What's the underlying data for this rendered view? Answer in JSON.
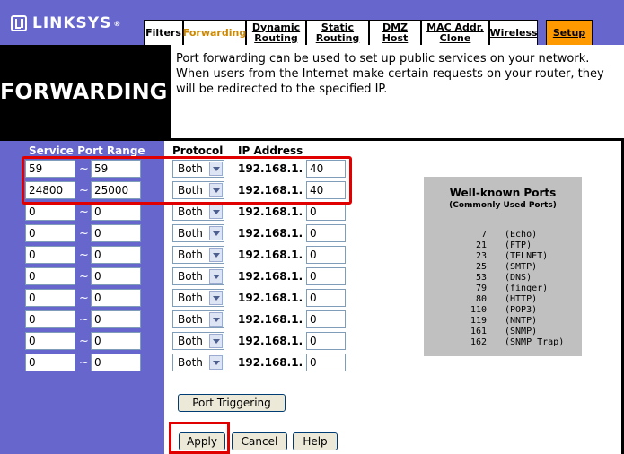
{
  "brand": {
    "name": "LINKSYS",
    "mark": "®"
  },
  "tabs": [
    {
      "label": "Filters",
      "underline": false
    },
    {
      "label": "Forwarding",
      "underline": false,
      "active": true
    },
    {
      "label": "Dynamic Routing",
      "underline": true
    },
    {
      "label": "Static Routing",
      "underline": true
    },
    {
      "label": "DMZ Host",
      "underline": true
    },
    {
      "label": "MAC Addr. Clone",
      "underline": true
    },
    {
      "label": "Wireless",
      "underline": true
    },
    {
      "label": "Setup",
      "underline": true,
      "accent": true
    }
  ],
  "page": {
    "title": "FORWARDING",
    "description": "Port forwarding can be used to set up public services on your network. When users from the Internet make certain requests on your router, they will be redirected to the specified IP."
  },
  "table": {
    "headers": {
      "service_port_range": "Service Port Range",
      "protocol": "Protocol",
      "ip_address": "IP Address"
    },
    "range_separator": "~",
    "ip_prefix": "192.168.1.",
    "rows": [
      {
        "start": "59",
        "end": "59",
        "protocol": "Both",
        "ip_last": "40"
      },
      {
        "start": "24800",
        "end": "25000",
        "protocol": "Both",
        "ip_last": "40"
      },
      {
        "start": "0",
        "end": "0",
        "protocol": "Both",
        "ip_last": "0"
      },
      {
        "start": "0",
        "end": "0",
        "protocol": "Both",
        "ip_last": "0"
      },
      {
        "start": "0",
        "end": "0",
        "protocol": "Both",
        "ip_last": "0"
      },
      {
        "start": "0",
        "end": "0",
        "protocol": "Both",
        "ip_last": "0"
      },
      {
        "start": "0",
        "end": "0",
        "protocol": "Both",
        "ip_last": "0"
      },
      {
        "start": "0",
        "end": "0",
        "protocol": "Both",
        "ip_last": "0"
      },
      {
        "start": "0",
        "end": "0",
        "protocol": "Both",
        "ip_last": "0"
      },
      {
        "start": "0",
        "end": "0",
        "protocol": "Both",
        "ip_last": "0"
      }
    ]
  },
  "well_known": {
    "title": "Well-known Ports",
    "subtitle": "(Commonly Used Ports)",
    "ports": [
      {
        "port": "7",
        "name": "(Echo)"
      },
      {
        "port": "21",
        "name": "(FTP)"
      },
      {
        "port": "23",
        "name": "(TELNET)"
      },
      {
        "port": "25",
        "name": "(SMTP)"
      },
      {
        "port": "53",
        "name": "(DNS)"
      },
      {
        "port": "79",
        "name": "(finger)"
      },
      {
        "port": "80",
        "name": "(HTTP)"
      },
      {
        "port": "110",
        "name": "(POP3)"
      },
      {
        "port": "119",
        "name": "(NNTP)"
      },
      {
        "port": "161",
        "name": "(SNMP)"
      },
      {
        "port": "162",
        "name": "(SNMP Trap)"
      }
    ]
  },
  "buttons": {
    "port_triggering": "Port Triggering",
    "apply": "Apply",
    "cancel": "Cancel",
    "help": "Help"
  },
  "colors": {
    "accent_purple": "#6666cc",
    "setup_orange": "#ff9900",
    "active_tab_text": "#cc8800",
    "highlight_red": "#e00000"
  }
}
